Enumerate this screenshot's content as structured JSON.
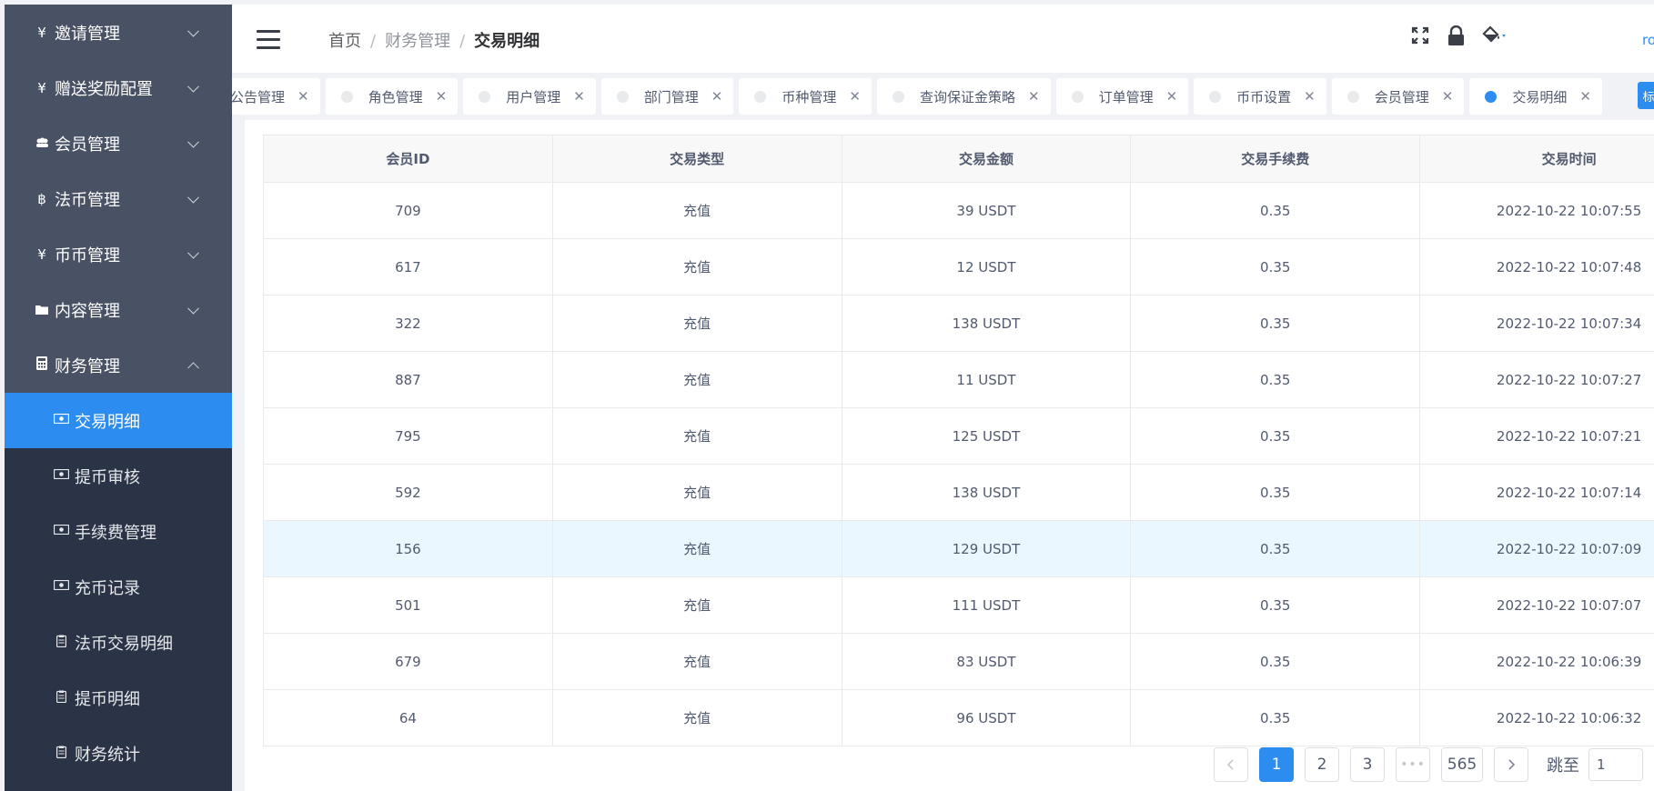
{
  "sidebar": {
    "groups": [
      {
        "label": "邀请管理",
        "icon": "yen-icon"
      },
      {
        "label": "赠送奖励配置",
        "icon": "yen-icon"
      },
      {
        "label": "会员管理",
        "icon": "members-icon"
      },
      {
        "label": "法币管理",
        "icon": "bitcoin-icon"
      },
      {
        "label": "币币管理",
        "icon": "yen-icon"
      },
      {
        "label": "内容管理",
        "icon": "folder-icon"
      },
      {
        "label": "财务管理",
        "icon": "calculator-icon",
        "expanded": true
      }
    ],
    "sub_items": [
      {
        "label": "交易明细",
        "icon": "money-icon",
        "active": true
      },
      {
        "label": "提币审核",
        "icon": "money-icon"
      },
      {
        "label": "手续费管理",
        "icon": "money-icon"
      },
      {
        "label": "充币记录",
        "icon": "money-icon"
      },
      {
        "label": "法币交易明细",
        "icon": "clipboard-icon"
      },
      {
        "label": "提币明细",
        "icon": "clipboard-icon"
      },
      {
        "label": "财务统计",
        "icon": "clipboard-icon"
      }
    ]
  },
  "header": {
    "breadcrumb": [
      "首页",
      "财务管理",
      "交易明细"
    ],
    "user": "ro",
    "tools": [
      "fullscreen-icon",
      "lock-icon",
      "paint-bucket-icon"
    ]
  },
  "tags": [
    {
      "label": "公告管理",
      "active": false
    },
    {
      "label": "角色管理",
      "active": false
    },
    {
      "label": "用户管理",
      "active": false
    },
    {
      "label": "部门管理",
      "active": false
    },
    {
      "label": "币种管理",
      "active": false
    },
    {
      "label": "查询保证金策略",
      "active": false
    },
    {
      "label": "订单管理",
      "active": false
    },
    {
      "label": "币币设置",
      "active": false
    },
    {
      "label": "会员管理",
      "active": false
    },
    {
      "label": "交易明细",
      "active": true
    }
  ],
  "tags_right_button": "标",
  "table": {
    "columns": [
      "会员ID",
      "交易类型",
      "交易金额",
      "交易手续费",
      "交易时间"
    ],
    "rows": [
      [
        "709",
        "充值",
        "39 USDT",
        "0.35",
        "2022-10-22 10:07:55"
      ],
      [
        "617",
        "充值",
        "12 USDT",
        "0.35",
        "2022-10-22 10:07:48"
      ],
      [
        "322",
        "充值",
        "138 USDT",
        "0.35",
        "2022-10-22 10:07:34"
      ],
      [
        "887",
        "充值",
        "11 USDT",
        "0.35",
        "2022-10-22 10:07:27"
      ],
      [
        "795",
        "充值",
        "125 USDT",
        "0.35",
        "2022-10-22 10:07:21"
      ],
      [
        "592",
        "充值",
        "138 USDT",
        "0.35",
        "2022-10-22 10:07:14"
      ],
      [
        "156",
        "充值",
        "129 USDT",
        "0.35",
        "2022-10-22 10:07:09"
      ],
      [
        "501",
        "充值",
        "111 USDT",
        "0.35",
        "2022-10-22 10:07:07"
      ],
      [
        "679",
        "充值",
        "83 USDT",
        "0.35",
        "2022-10-22 10:06:39"
      ],
      [
        "64",
        "充值",
        "96 USDT",
        "0.35",
        "2022-10-22 10:06:32"
      ]
    ],
    "highlighted_row": 6
  },
  "pagination": {
    "pages": [
      "1",
      "2",
      "3"
    ],
    "current": "1",
    "ellipsis": "•••",
    "last": "565",
    "jump_label": "跳至",
    "jump_value": "1"
  }
}
